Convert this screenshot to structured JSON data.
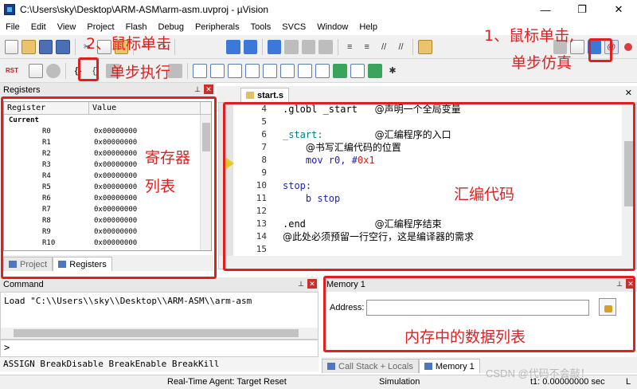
{
  "window": {
    "title": "C:\\Users\\sky\\Desktop\\ARM-ASM\\arm-asm.uvproj - µVision",
    "controls": [
      "—",
      "❐",
      "✕"
    ]
  },
  "menu": [
    "File",
    "Edit",
    "View",
    "Project",
    "Flash",
    "Debug",
    "Peripherals",
    "Tools",
    "SVCS",
    "Window",
    "Help"
  ],
  "toolbar2": {
    "rst_label": "RST",
    "step_icon_text": "{}",
    "step_over_text": "{}"
  },
  "registers_panel": {
    "title": "Registers",
    "columns": [
      "Register",
      "Value"
    ],
    "group": "Current",
    "rows": [
      {
        "name": "R0",
        "value": "0x00000000"
      },
      {
        "name": "R1",
        "value": "0x00000000"
      },
      {
        "name": "R2",
        "value": "0x00000000"
      },
      {
        "name": "R3",
        "value": "0x00000000"
      },
      {
        "name": "R4",
        "value": "0x00000000"
      },
      {
        "name": "R5",
        "value": "0x00000000"
      },
      {
        "name": "R6",
        "value": "0x00000000"
      },
      {
        "name": "R7",
        "value": "0x00000000"
      },
      {
        "name": "R8",
        "value": "0x00000000"
      },
      {
        "name": "R9",
        "value": "0x00000000"
      },
      {
        "name": "R10",
        "value": "0x00000000"
      }
    ],
    "tabs": [
      "Project",
      "Registers"
    ]
  },
  "editor": {
    "tab": "start.s",
    "line_numbers": [
      "4",
      "5",
      "6",
      "7",
      "8",
      "9",
      "10",
      "11",
      "12",
      "13",
      "14",
      "15"
    ],
    "current_line": "8"
  },
  "command_panel": {
    "title": "Command",
    "output": "Load \"C:\\\\Users\\\\sky\\\\Desktop\\\\ARM-ASM\\\\arm-asm",
    "prompt": ">",
    "help": "ASSIGN BreakDisable BreakEnable BreakKill"
  },
  "memory_panel": {
    "title": "Memory 1",
    "address_label": "Address:",
    "address_value": "",
    "tabs": [
      "Call Stack + Locals",
      "Memory 1"
    ]
  },
  "statusbar": {
    "agent": "Real-Time Agent: Target Reset",
    "mode": "Simulation",
    "time": "t1: 0.00000000 sec",
    "extra": "L"
  },
  "annotations": {
    "step_exec_1": "2、鼠标单击",
    "step_exec_2": "单步执行",
    "debug_1": "1、鼠标单击,",
    "debug_2": "单步仿真",
    "reg_1": "寄存器",
    "reg_2": "列表",
    "code": "汇编代码",
    "memory": "内存中的数据列表"
  },
  "watermark": "CSDN @代码不会敲！",
  "colors": {
    "annotation_red": "#e02020",
    "keyword_blue": "#2020c0",
    "number_red": "#d02020",
    "label_teal": "#008080"
  }
}
